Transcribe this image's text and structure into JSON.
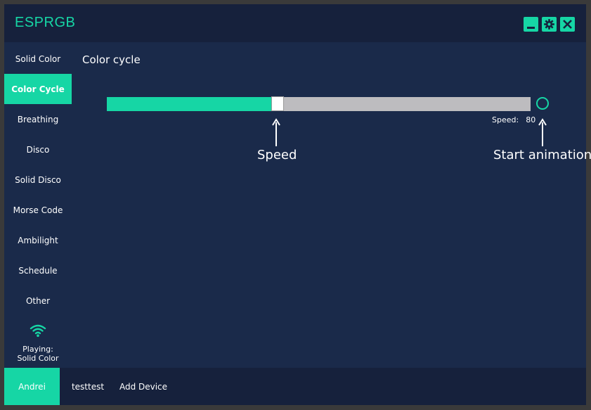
{
  "app": {
    "title": "ESPRGB"
  },
  "window_controls": {
    "minimize_icon": "minimize-icon",
    "settings_icon": "gear-icon",
    "close_icon": "close-icon"
  },
  "sidebar": {
    "items": [
      {
        "label": "Solid Color",
        "active": false
      },
      {
        "label": "Color Cycle",
        "active": true
      },
      {
        "label": "Breathing",
        "active": false
      },
      {
        "label": "Disco",
        "active": false
      },
      {
        "label": "Solid Disco",
        "active": false
      },
      {
        "label": "Morse Code",
        "active": false
      },
      {
        "label": "Ambilight",
        "active": false
      },
      {
        "label": "Schedule",
        "active": false
      },
      {
        "label": "Other",
        "active": false
      }
    ],
    "status_icon": "wifi-icon",
    "playing_label": "Playing:",
    "playing_value": "Solid Color"
  },
  "main": {
    "title": "Color cycle",
    "speed_slider": {
      "value": 80,
      "min": 0,
      "max": 200
    },
    "speed_label": "Speed:",
    "speed_value": "80",
    "start_button_icon": "circle-icon"
  },
  "annotations": {
    "speed": "Speed",
    "start": "Start animation"
  },
  "users": {
    "tabs": [
      {
        "label": "Andrei",
        "active": true
      },
      {
        "label": "testtest",
        "active": false
      },
      {
        "label": "Add Device",
        "active": false
      }
    ]
  },
  "colors": {
    "accent": "#16d6a5",
    "background": "#1a2a4a",
    "bar": "#16213c",
    "track": "#bdbcbf"
  }
}
